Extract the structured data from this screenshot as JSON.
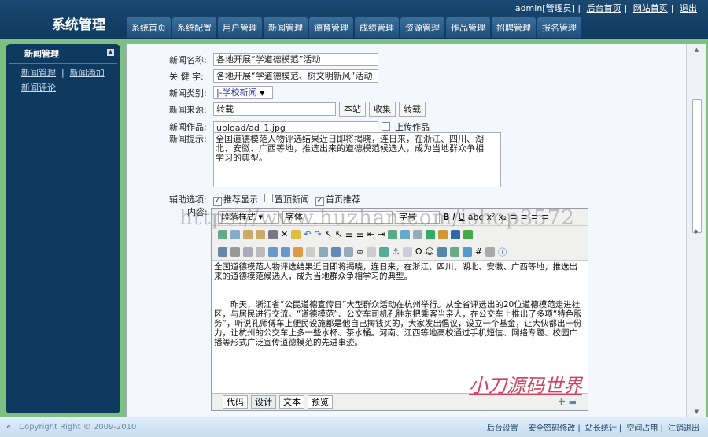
{
  "header": {
    "title": "系统管理",
    "user": "admin[管理员]",
    "links": [
      "后台首页",
      "网站首页",
      "退出"
    ]
  },
  "tabs": [
    "系统首页",
    "系统配置",
    "用户管理",
    "新闻管理",
    "德育管理",
    "成绩管理",
    "资源管理",
    "作品管理",
    "招聘管理",
    "报名管理"
  ],
  "sidebar": {
    "title": "新闻管理",
    "links": [
      "新闻管理",
      "新闻添加",
      "新闻评论"
    ]
  },
  "form": {
    "name_label": "新闻名称:",
    "name_value": "各地开展“学道德模范”活动",
    "keyword_label": "关 健 字:",
    "keyword_value": "各地开展“学道德模范、树文明新风”活动",
    "category_label": "新闻类别:",
    "category_value": "|-学校新闻",
    "source_label": "新闻来源:",
    "source_value": "转载",
    "source_buttons": [
      "本站",
      "收集",
      "转载"
    ],
    "work_label": "新闻作品:",
    "work_value": "upload/ad_1.jpg",
    "upload_label": "上传作品",
    "hint_label": "新闻提示:",
    "hint_value": "全国道德模范人物评选结果近日即将揭晓，连日来，在浙江、四川、湖北、安徽、广西等地，推选出来的道德模范候选人，成为当地群众争相学习的典型。",
    "options_label": "辅助选项:",
    "options": [
      {
        "label": "推荐显示",
        "checked": true
      },
      {
        "label": "置顶新闻",
        "checked": false
      },
      {
        "label": "首页推荐",
        "checked": true
      }
    ],
    "content_label": "内容:"
  },
  "editor": {
    "paragraph_style": "段落样式",
    "font": "字体",
    "font_size": "字号",
    "para1": "全国道德模范人物评选结果近日即将揭晓，连日来，在浙江、四川、湖北、安徽、广西等地，推选出来的道德模范候选人，成为当地群众争相学习的典型。",
    "para2": "　　昨天，浙江省“公民道德宣传日”大型群众活动在杭州举行。从全省评选出的20位道德模范走进社区，与居民进行交流。“道德模范”、公交车司机孔胜东把乘客当亲人，在公交车上推出了多项“特色服务”，听说孔师傅车上便民设施都是他自己掏钱买的，大家发出倡议，设立一个基金，让大伙都出一份力，让杭州的公交车上多一些水杯、茶水桶。河南、江西等地高校通过手机短信、网络专题、校园广播等形式广泛宣传道德模范的先进事迹。",
    "modes": [
      "代码",
      "设计",
      "文本",
      "预览"
    ]
  },
  "watermark": "小刀源码世界",
  "url_watermark": "https://www.huzhan.com/ishop3572",
  "footer": {
    "copyright": "Copyright Right © 2009-2010",
    "links": [
      "后台设置",
      "安全密码修改",
      "站长统计",
      "空间占用",
      "注销退出"
    ]
  }
}
